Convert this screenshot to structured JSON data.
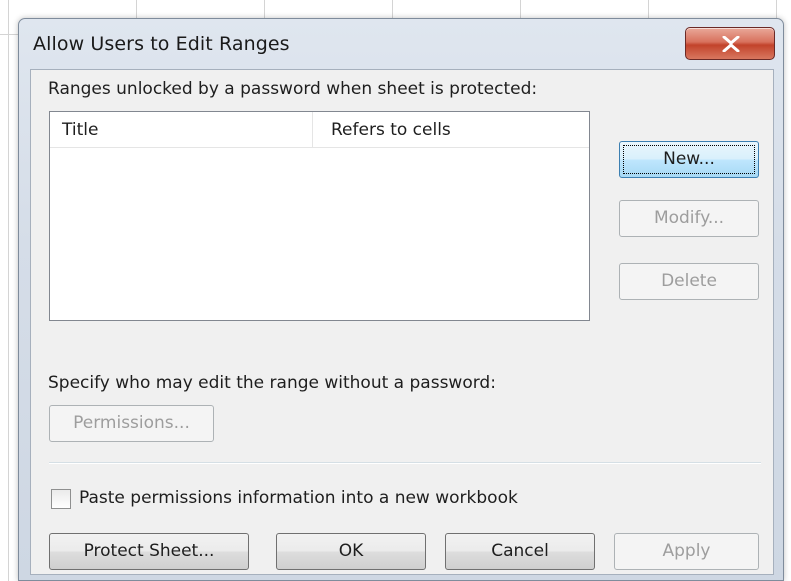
{
  "dialog": {
    "title": "Allow Users to Edit Ranges"
  },
  "ranges_label": "Ranges unlocked by a password when sheet is protected:",
  "list": {
    "columns": [
      "Title",
      "Refers to cells"
    ],
    "rows": []
  },
  "buttons": {
    "new": "New...",
    "modify": "Modify...",
    "delete": "Delete",
    "permissions": "Permissions...",
    "protect_sheet": "Protect Sheet...",
    "ok": "OK",
    "cancel": "Cancel",
    "apply": "Apply"
  },
  "permissions_label": "Specify who may edit the range without a password:",
  "paste_checkbox": {
    "label": "Paste permissions information into a new workbook",
    "checked": false
  },
  "icons": {
    "close": "close-icon"
  }
}
